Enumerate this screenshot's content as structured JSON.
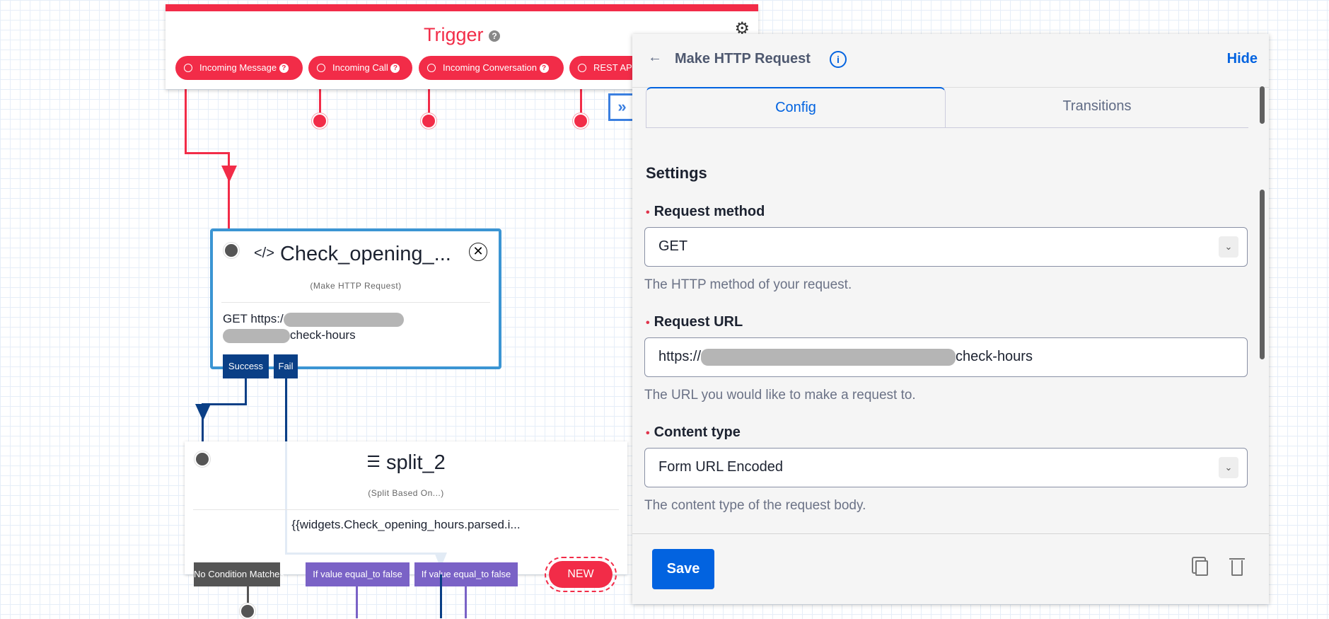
{
  "trigger": {
    "title": "Trigger",
    "help_icon": "question-circle-icon",
    "settings_icon": "gears-icon",
    "pills": [
      "Incoming Message",
      "Incoming Call",
      "Incoming Conversation",
      "REST API"
    ]
  },
  "http_card": {
    "title": "Check_opening_...",
    "subtitle": "(Make HTTP Request)",
    "body_prefix": "GET https:/",
    "body_suffix": "check-hours",
    "transitions": [
      "Success",
      "Fail"
    ],
    "icon": "code-icon",
    "close_icon": "close-circle-icon"
  },
  "split_card": {
    "title": "split_2",
    "subtitle": "(Split Based On...)",
    "body": "{{widgets.Check_opening_hours.parsed.i...",
    "icon": "split-icon",
    "transitions": [
      {
        "label": "No Condition Matches",
        "color": "#555555"
      },
      {
        "label": "If value equal_to false",
        "color": "#7a62c6"
      },
      {
        "label": "If value equal_to false",
        "color": "#7a62c6"
      }
    ],
    "new_label": "NEW"
  },
  "panel": {
    "title": "Make HTTP Request",
    "hide": "Hide",
    "tabs": [
      "Config",
      "Transitions"
    ],
    "section": "Settings",
    "fields": [
      {
        "label": "Request method",
        "value": "GET",
        "help": "The HTTP method of your request."
      },
      {
        "label": "Request URL",
        "value_prefix": "https://",
        "value_suffix": "check-hours",
        "help": "The URL you would like to make a request to."
      },
      {
        "label": "Content type",
        "value": "Form URL Encoded",
        "help": "The content type of the request body."
      }
    ],
    "save": "Save"
  },
  "colors": {
    "trigger_red": "#f22c48",
    "accent_blue": "#0263e0",
    "transition_navy": "#0a3f86",
    "selected_border": "#3b95d3"
  }
}
